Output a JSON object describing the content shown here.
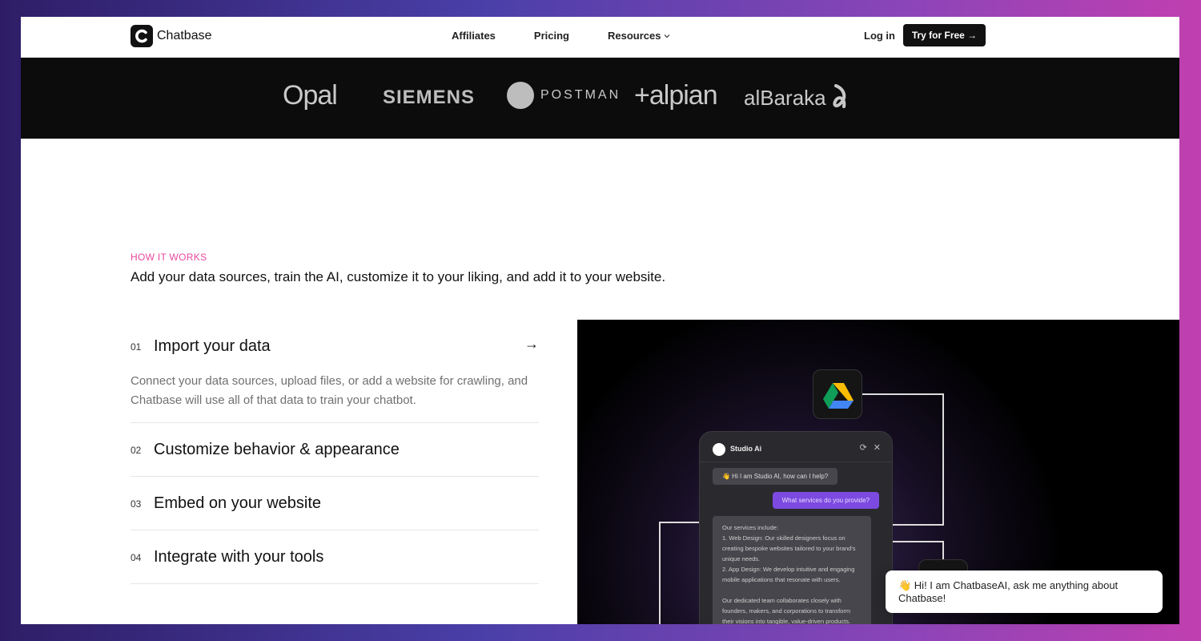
{
  "nav": {
    "brand": "Chatbase",
    "links": [
      "Affiliates",
      "Pricing",
      "Resources"
    ],
    "login": "Log in",
    "cta": "Try for Free →"
  },
  "logos": [
    "Opal",
    "SIEMENS",
    "POSTMAN",
    "+alpian",
    "alBaraka"
  ],
  "how": {
    "kicker": "HOW IT WORKS",
    "headline": "Add your data sources, train the AI, customize it to your liking, and add it to your website.",
    "steps": [
      {
        "num": "01",
        "title": "Import your data",
        "desc": "Connect your data sources, upload files, or add a website for crawling, and Chatbase will use all of that data to train your chatbot."
      },
      {
        "num": "02",
        "title": "Customize behavior & appearance"
      },
      {
        "num": "03",
        "title": "Embed on your website"
      },
      {
        "num": "04",
        "title": "Integrate with your tools"
      }
    ]
  },
  "demo": {
    "bot_name": "Studio Ai",
    "greeting": "👋 Hi I am Studio AI, how can I help?",
    "user_msg": "What services do you provide?",
    "reply_lines": [
      "Our services include:",
      "1. Web Design: Our skilled designers focus on creating bespoke websites tailored to your brand's unique needs.",
      "2. App Design: We develop intuitive and engaging mobile applications that resonate with users.",
      "",
      "Our dedicated team collaborates closely with founders, makers, and corporations to transform their visions into tangible, value-driven products."
    ]
  },
  "widget": {
    "text": "👋 Hi! I am ChatbaseAI, ask me anything about Chatbase!"
  },
  "colors": {
    "accent": "#e8489c",
    "purple": "#7c4ae0",
    "dark": "#0c0c0c"
  }
}
